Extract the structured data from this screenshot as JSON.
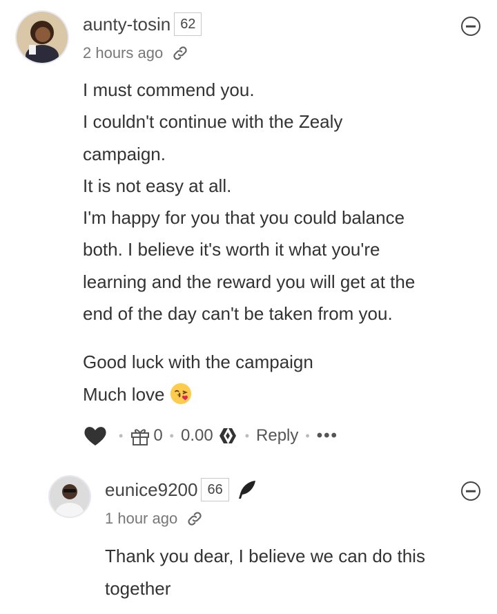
{
  "comments": [
    {
      "author": "aunty-tosin",
      "reputation": "62",
      "time": "2 hours ago",
      "body_lines": [
        "I must commend you.",
        "I couldn't continue with the Zealy",
        "campaign.",
        "It is not easy at all.",
        "I'm happy for you that you could balance",
        "both. I believe it's worth it what you're",
        "learning and the reward you will get at the",
        "end of the day can't be taken from you."
      ],
      "closing_lines": [
        "Good luck with the campaign",
        "Much love"
      ],
      "actions": {
        "gift_count": "0",
        "payout": "0.00",
        "reply_label": "Reply",
        "more_label": "•••"
      }
    },
    {
      "author": "eunice9200",
      "reputation": "66",
      "time": "1 hour ago",
      "body_lines": [
        "Thank you dear, I believe we can do this",
        "together"
      ]
    }
  ],
  "icons": {
    "collapse": "minus-circle-icon",
    "link": "link-icon",
    "heart": "heart-icon",
    "gift": "gift-icon",
    "hive": "hive-logo-icon",
    "feather": "feather-icon",
    "emoji": "kissing-face-emoji"
  },
  "colors": {
    "text": "#333333",
    "muted": "#777777",
    "hive_red": "#e31337"
  }
}
